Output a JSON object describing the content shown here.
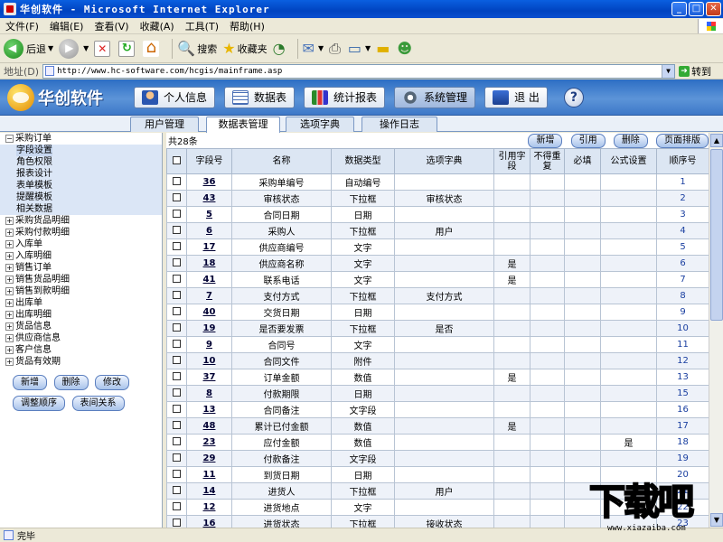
{
  "window": {
    "title": "华创软件 - Microsoft Internet Explorer"
  },
  "menu": [
    "文件(F)",
    "编辑(E)",
    "查看(V)",
    "收藏(A)",
    "工具(T)",
    "帮助(H)"
  ],
  "toolbar": {
    "back": "后退",
    "search": "搜索",
    "favorites": "收藏夹"
  },
  "address": {
    "label": "地址(D)",
    "url": "http://www.hc-software.com/hcgis/mainframe.asp",
    "go": "转到"
  },
  "app": {
    "logo": "华创软件",
    "nav": [
      "个人信息",
      "数据表",
      "统计报表",
      "系统管理",
      "退 出"
    ],
    "help": "?"
  },
  "tabs": [
    "用户管理",
    "数据表管理",
    "选项字典",
    "操作日志"
  ],
  "tree": [
    {
      "label": "采购订单",
      "children": [
        "字段设置",
        "角色权限",
        "报表设计",
        "表单模板",
        "提醒模板",
        "相关数据"
      ]
    },
    {
      "label": "采购货品明细"
    },
    {
      "label": "采购付款明细"
    },
    {
      "label": "入库单"
    },
    {
      "label": "入库明细"
    },
    {
      "label": "销售订单"
    },
    {
      "label": "销售货品明细"
    },
    {
      "label": "销售到款明细"
    },
    {
      "label": "出库单"
    },
    {
      "label": "出库明细"
    },
    {
      "label": "货品信息"
    },
    {
      "label": "供应商信息"
    },
    {
      "label": "客户信息"
    },
    {
      "label": "货品有效期"
    }
  ],
  "left_buttons": [
    "新增",
    "删除",
    "修改",
    "调整顺序",
    "表间关系"
  ],
  "content": {
    "count": "共28条",
    "buttons": [
      "新增",
      "引用",
      "删除",
      "页面排版"
    ],
    "columns": [
      "字段号",
      "名称",
      "数据类型",
      "选项字典",
      "引用字段",
      "不得重复",
      "必填",
      "公式设置",
      "顺序号"
    ],
    "rows": [
      [
        "36",
        "采购单编号",
        "自动编号",
        "",
        "",
        "",
        "",
        "",
        "1"
      ],
      [
        "43",
        "审核状态",
        "下拉框",
        "审核状态",
        "",
        "",
        "",
        "",
        "2"
      ],
      [
        "5",
        "合同日期",
        "日期",
        "",
        "",
        "",
        "",
        "",
        "3"
      ],
      [
        "6",
        "采购人",
        "下拉框",
        "用户",
        "",
        "",
        "",
        "",
        "4"
      ],
      [
        "17",
        "供应商编号",
        "文字",
        "",
        "",
        "",
        "",
        "",
        "5"
      ],
      [
        "18",
        "供应商名称",
        "文字",
        "",
        "是",
        "",
        "",
        "",
        "6"
      ],
      [
        "41",
        "联系电话",
        "文字",
        "",
        "是",
        "",
        "",
        "",
        "7"
      ],
      [
        "7",
        "支付方式",
        "下拉框",
        "支付方式",
        "",
        "",
        "",
        "",
        "8"
      ],
      [
        "40",
        "交货日期",
        "日期",
        "",
        "",
        "",
        "",
        "",
        "9"
      ],
      [
        "19",
        "是否要发票",
        "下拉框",
        "是否",
        "",
        "",
        "",
        "",
        "10"
      ],
      [
        "9",
        "合同号",
        "文字",
        "",
        "",
        "",
        "",
        "",
        "11"
      ],
      [
        "10",
        "合同文件",
        "附件",
        "",
        "",
        "",
        "",
        "",
        "12"
      ],
      [
        "37",
        "订单金额",
        "数值",
        "",
        "是",
        "",
        "",
        "",
        "13"
      ],
      [
        "8",
        "付款期限",
        "日期",
        "",
        "",
        "",
        "",
        "",
        "15"
      ],
      [
        "13",
        "合同备注",
        "文字段",
        "",
        "",
        "",
        "",
        "",
        "16"
      ],
      [
        "48",
        "累计已付金额",
        "数值",
        "",
        "是",
        "",
        "",
        "",
        "17"
      ],
      [
        "23",
        "应付金额",
        "数值",
        "",
        "",
        "",
        "",
        "是",
        "18"
      ],
      [
        "29",
        "付款备注",
        "文字段",
        "",
        "",
        "",
        "",
        "",
        "19"
      ],
      [
        "11",
        "到货日期",
        "日期",
        "",
        "",
        "",
        "",
        "",
        "20"
      ],
      [
        "14",
        "进货人",
        "下拉框",
        "用户",
        "",
        "",
        "",
        "",
        "21"
      ],
      [
        "12",
        "进货地点",
        "文字",
        "",
        "",
        "",
        "",
        "",
        "22"
      ],
      [
        "16",
        "进货状态",
        "下拉框",
        "接收状态",
        "",
        "",
        "",
        "",
        "23"
      ]
    ]
  },
  "status": {
    "text": "完毕"
  },
  "watermark": {
    "text": "下载吧",
    "url": "www.xiazaiba.com"
  }
}
